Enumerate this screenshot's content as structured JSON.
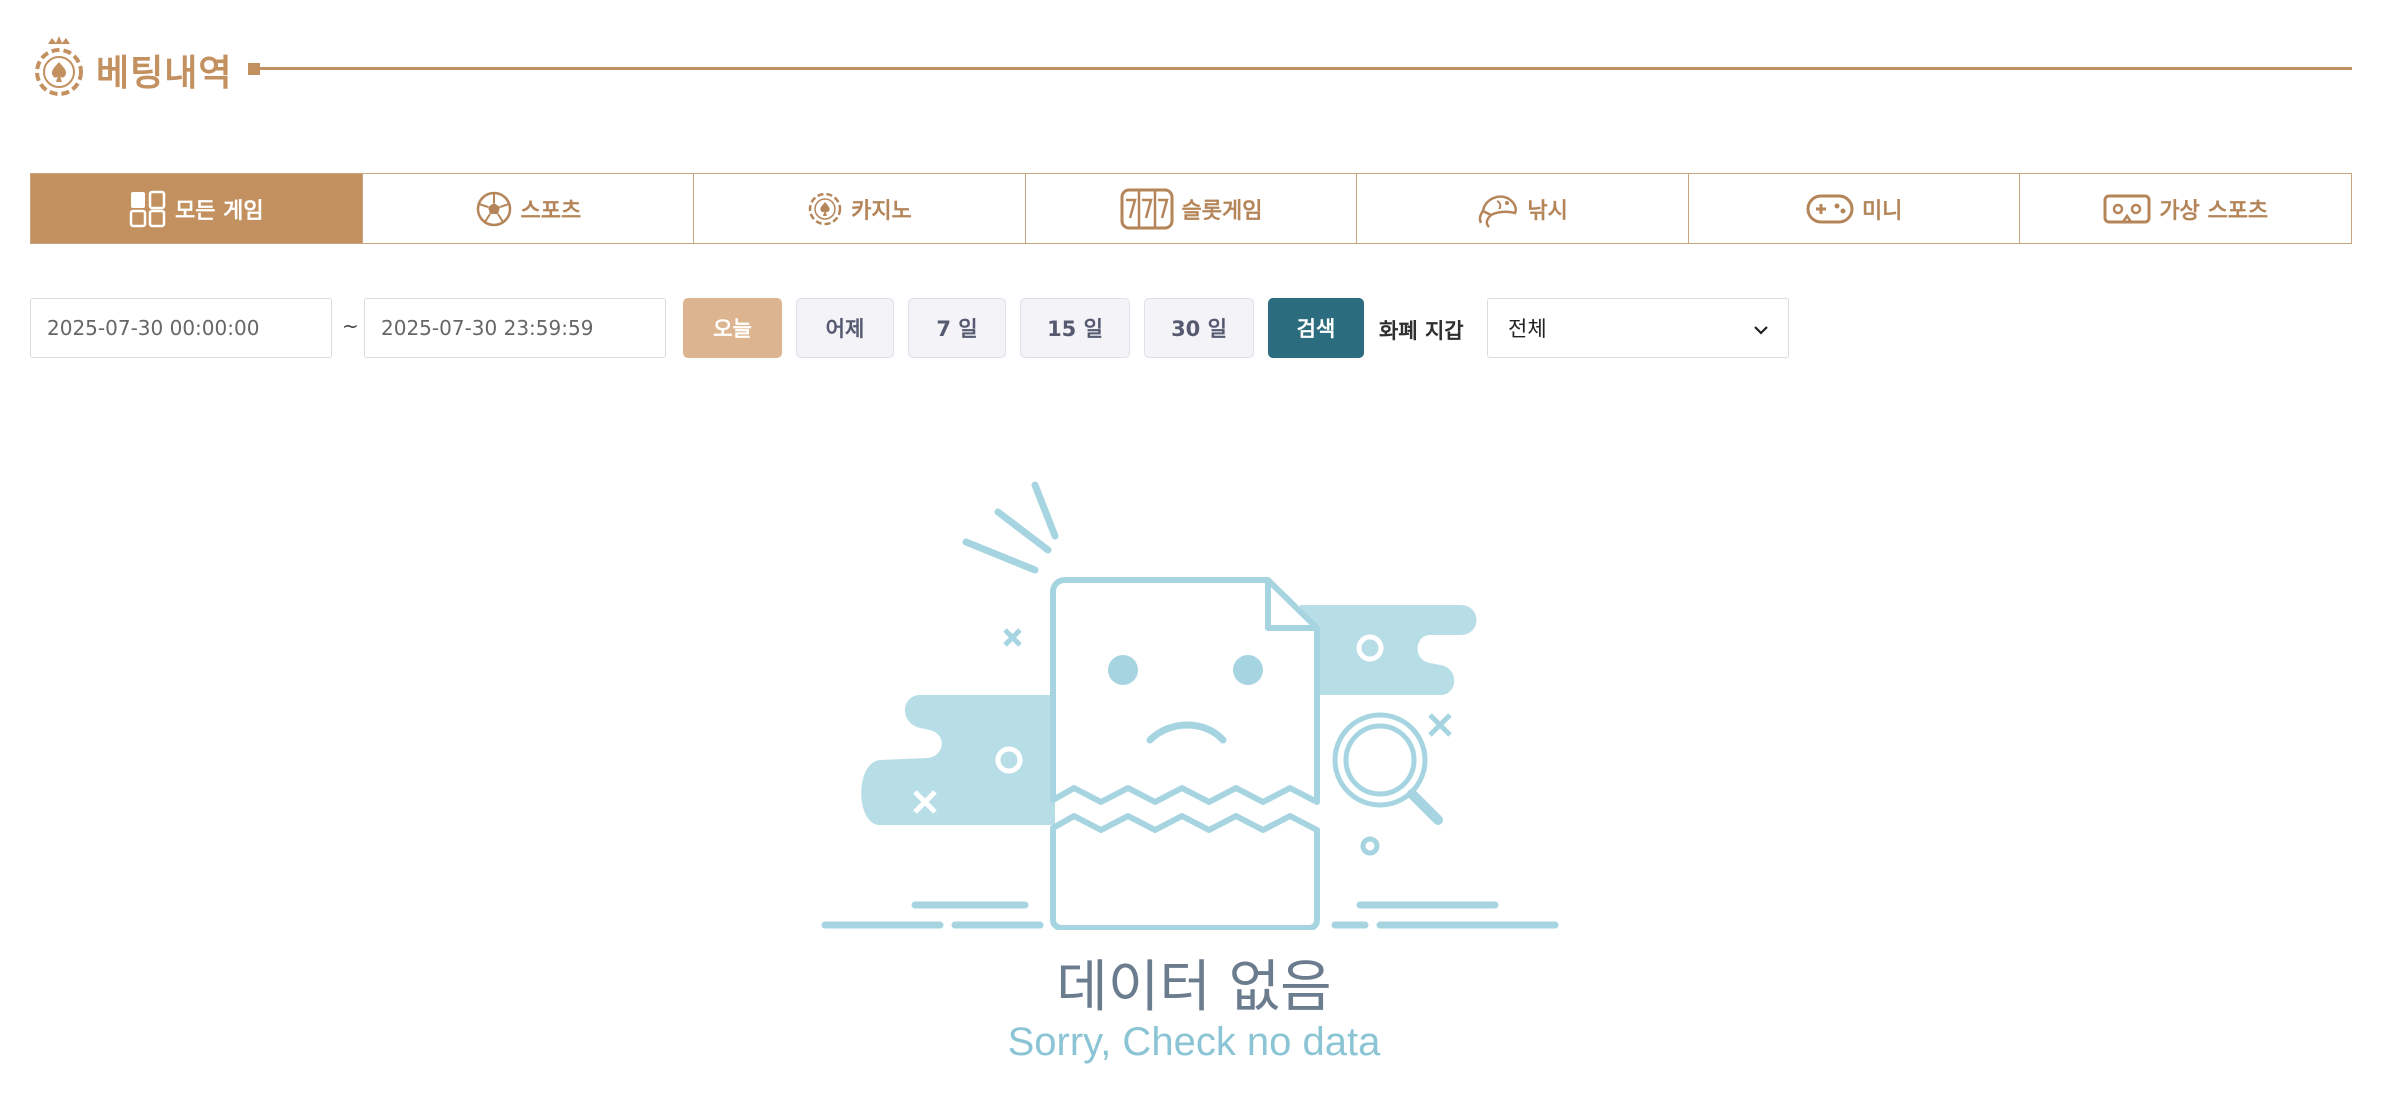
{
  "header": {
    "title": "베팅내역",
    "icon": "spade-chip-icon"
  },
  "tabs": [
    {
      "label": "모든 게임",
      "icon": "grid-icon",
      "active": true
    },
    {
      "label": "스포츠",
      "icon": "soccer-ball-icon",
      "active": false
    },
    {
      "label": "카지노",
      "icon": "casino-chip-icon",
      "active": false
    },
    {
      "label": "슬롯게임",
      "icon": "slot-777-icon",
      "active": false
    },
    {
      "label": "낚시",
      "icon": "fish-icon",
      "active": false
    },
    {
      "label": "미니",
      "icon": "gamepad-icon",
      "active": false
    },
    {
      "label": "가상 스포츠",
      "icon": "vr-goggles-icon",
      "active": false
    }
  ],
  "filter": {
    "start_date": "2025-07-30 00:00:00",
    "tilde": "~",
    "end_date": "2025-07-30 23:59:59",
    "buttons": {
      "today": "오늘",
      "yesterday": "어제",
      "d7": "7 일",
      "d15": "15 일",
      "d30": "30 일",
      "search": "검색"
    },
    "wallet_label": "화폐 지갑",
    "wallet_value": "전체"
  },
  "empty_state": {
    "title": "데이터 없음",
    "subtitle": "Sorry, Check no data",
    "illustration": "torn-document-sad-face"
  },
  "colors": {
    "brand": "#c3905f",
    "today_button": "#dcb48f",
    "search_button": "#2b6d7e",
    "empty_illustration": "#a6d5e1"
  }
}
